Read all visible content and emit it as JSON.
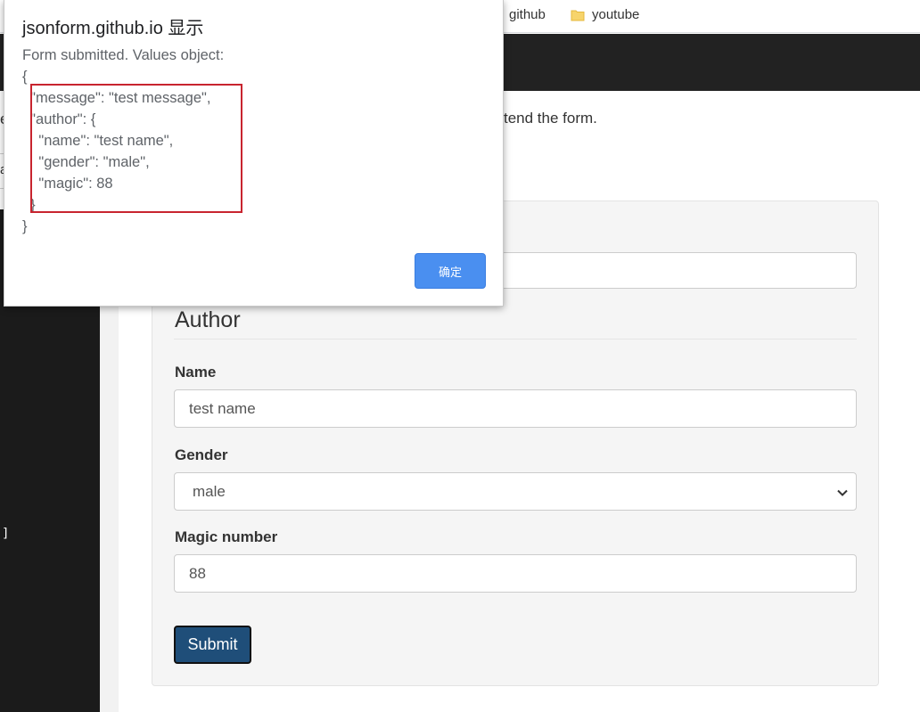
{
  "bookmarks": {
    "items": [
      {
        "label": "github",
        "icon": "folder-icon"
      },
      {
        "label": "youtube",
        "icon": "folder-icon"
      }
    ]
  },
  "page": {
    "intro_text": "tend the form.",
    "left_fragment_e": "e",
    "left_fragment_a": "a",
    "left_bracket": "]"
  },
  "form": {
    "legend": "Author",
    "fields": {
      "name": {
        "label": "Name",
        "value": "test name"
      },
      "gender": {
        "label": "Gender",
        "value": "male"
      },
      "magic": {
        "label": "Magic number",
        "value": "88"
      }
    },
    "submit_label": "Submit"
  },
  "dialog": {
    "title": "jsonform.github.io 显示",
    "body": "Form submitted. Values object:\n{\n  \"message\": \"test message\",\n  \"author\": {\n    \"name\": \"test name\",\n    \"gender\": \"male\",\n    \"magic\": 88\n  }\n}",
    "ok_label": "确定"
  },
  "colors": {
    "navbar": "#222222",
    "submit": "#1f4e79",
    "ok_button": "#4a8ff0",
    "highlight": "#c8242f"
  }
}
